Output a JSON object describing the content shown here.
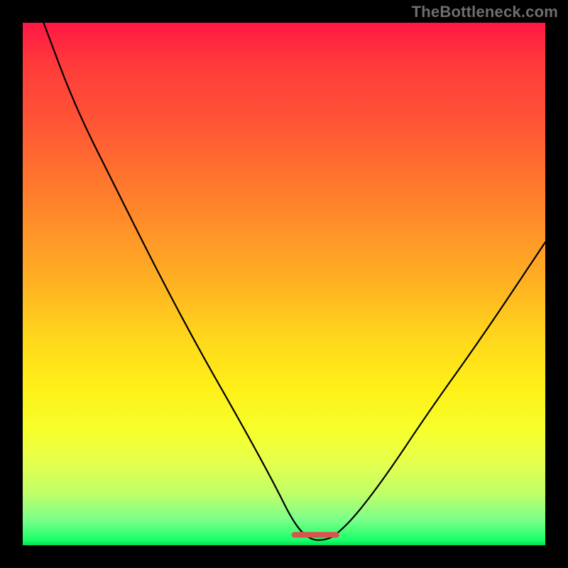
{
  "watermark": "TheBottleneck.com",
  "chart_data": {
    "type": "line",
    "title": "",
    "xlabel": "",
    "ylabel": "",
    "xlim": [
      0,
      100
    ],
    "ylim": [
      0,
      100
    ],
    "series": [
      {
        "name": "bottleneck-curve",
        "x": [
          4,
          10,
          18,
          26,
          34,
          42,
          48,
          52,
          55,
          58,
          60,
          64,
          70,
          78,
          88,
          100
        ],
        "values": [
          100,
          84,
          68,
          52,
          37,
          23,
          12,
          4,
          1,
          1,
          2,
          6,
          14,
          26,
          40,
          58
        ]
      }
    ],
    "annotations": [
      {
        "name": "optimal-marker",
        "type": "segment",
        "color": "#d9534f",
        "x": [
          52,
          60
        ],
        "y": [
          2,
          2
        ]
      }
    ],
    "grid": false,
    "legend": false
  },
  "colors": {
    "curve": "#000000",
    "marker": "#d9534f",
    "background_top": "#ff1744",
    "background_bottom": "#00e05a",
    "frame": "#000000"
  }
}
